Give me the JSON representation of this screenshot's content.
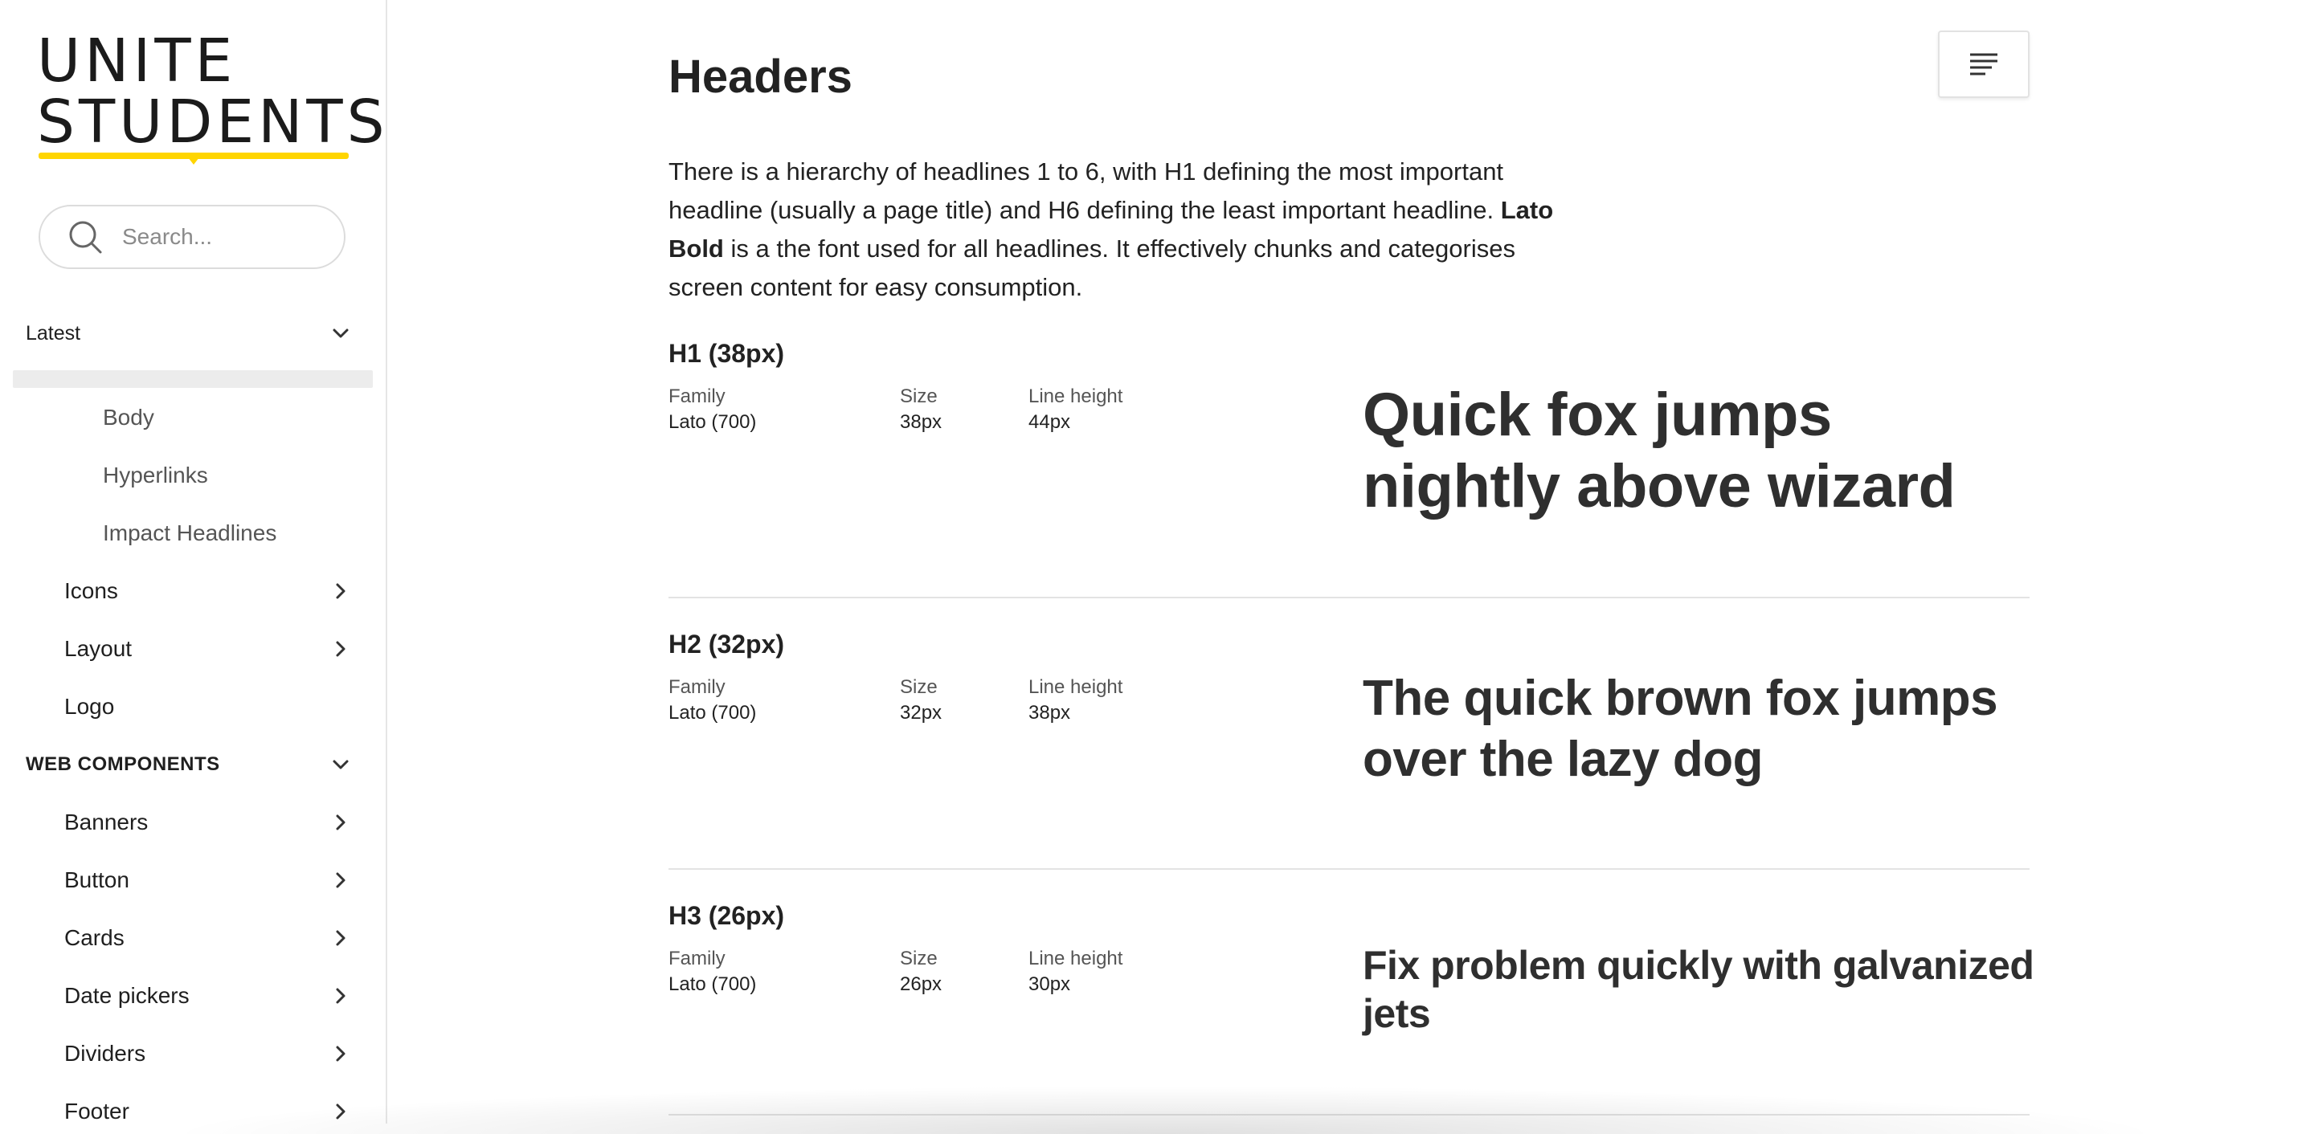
{
  "sidebar": {
    "logo": {
      "line1": "UNITE",
      "line2": "STUDENTS"
    },
    "search": {
      "placeholder": "Search..."
    },
    "sections": {
      "latest": "Latest",
      "web_components": "WEB COMPONENTS"
    },
    "sub_items": [
      "Body",
      "Hyperlinks",
      "Impact Headlines"
    ],
    "foundation_items": [
      "Icons",
      "Layout",
      "Logo"
    ],
    "component_items": [
      "Banners",
      "Button",
      "Cards",
      "Date pickers",
      "Dividers",
      "Footer"
    ]
  },
  "main": {
    "title": "Headers",
    "intro": {
      "part1": "There is a hierarchy of headlines 1 to 6, with H1 defining the most important headline (usually a page title) and H6 defining the least important headline. ",
      "bold": "Lato Bold",
      "part2": " is a the font used for all headlines. It effectively chunks and categorises screen content for easy consumption."
    },
    "labels": {
      "family": "Family",
      "size": "Size",
      "line_height": "Line height"
    },
    "headings": [
      {
        "title": "H1 (38px)",
        "family": "Lato (700)",
        "size": "38px",
        "line_height": "44px",
        "sample": "Quick fox jumps nightly above wizard"
      },
      {
        "title": "H2 (32px)",
        "family": "Lato (700)",
        "size": "32px",
        "line_height": "38px",
        "sample": "The quick brown fox jumps over the lazy dog"
      },
      {
        "title": "H3 (26px)",
        "family": "Lato (700)",
        "size": "26px",
        "line_height": "30px",
        "sample": "Fix problem quickly with galvanized jets"
      }
    ]
  },
  "icons": {
    "search": "search-icon",
    "chevron_down": "chevron-down-icon",
    "chevron_right": "chevron-right-icon",
    "menu": "text-align-icon"
  },
  "colors": {
    "brand_yellow": "#ffd500",
    "text": "#222222",
    "divider": "#e3e3e3"
  }
}
